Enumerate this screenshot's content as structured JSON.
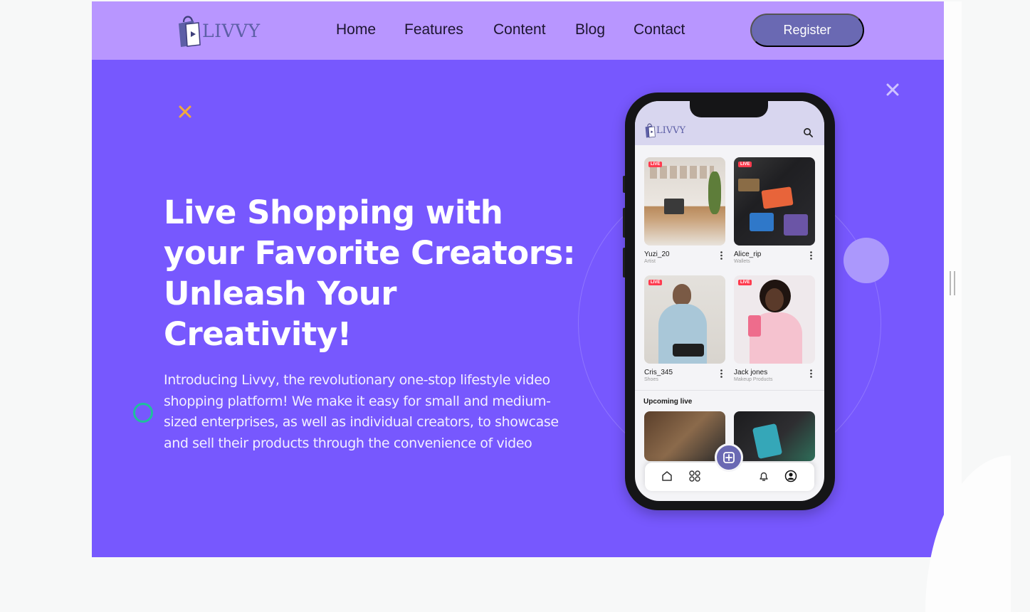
{
  "brand": {
    "name": "LIVVY"
  },
  "nav": {
    "items": [
      {
        "label": "Home"
      },
      {
        "label": "Features"
      },
      {
        "label": "Content"
      },
      {
        "label": "Blog"
      },
      {
        "label": "Contact"
      }
    ],
    "register_label": "Register"
  },
  "hero": {
    "headline_lines": [
      "Live Shopping with",
      "your Favorite Creators:",
      "Unleash Your",
      "Creativity!"
    ],
    "lede_lines": [
      "Introducing Livvy, the revolutionary one-stop lifestyle video",
      "shopping platform! We make it easy for small and medium-",
      "sized enterprises, as well as individual creators, to showcase",
      "and sell their products through the convenience of video"
    ]
  },
  "phone": {
    "app_name": "LIVVY",
    "live_badge": "LIVE",
    "cards": [
      {
        "name": "Yuzi_20",
        "sub": "Artist"
      },
      {
        "name": "Alice_rip",
        "sub": "Wallets"
      },
      {
        "name": "Cris_345",
        "sub": "Shoes"
      },
      {
        "name": "Jack jones",
        "sub": "Makeup Products"
      }
    ],
    "upcoming_title": "Upcoming live"
  },
  "colors": {
    "hero_bg": "#7758fe",
    "header_bg": "#b896ff",
    "button": "#6a69b3",
    "accent_orange": "#f2a93b",
    "accent_teal": "#1fbf9c"
  },
  "icons": [
    "bag-play-icon",
    "close-icon",
    "search-icon",
    "more-vertical-icon",
    "home-icon",
    "grid-icon",
    "plus-square-icon",
    "bell-icon",
    "user-circle-icon"
  ]
}
